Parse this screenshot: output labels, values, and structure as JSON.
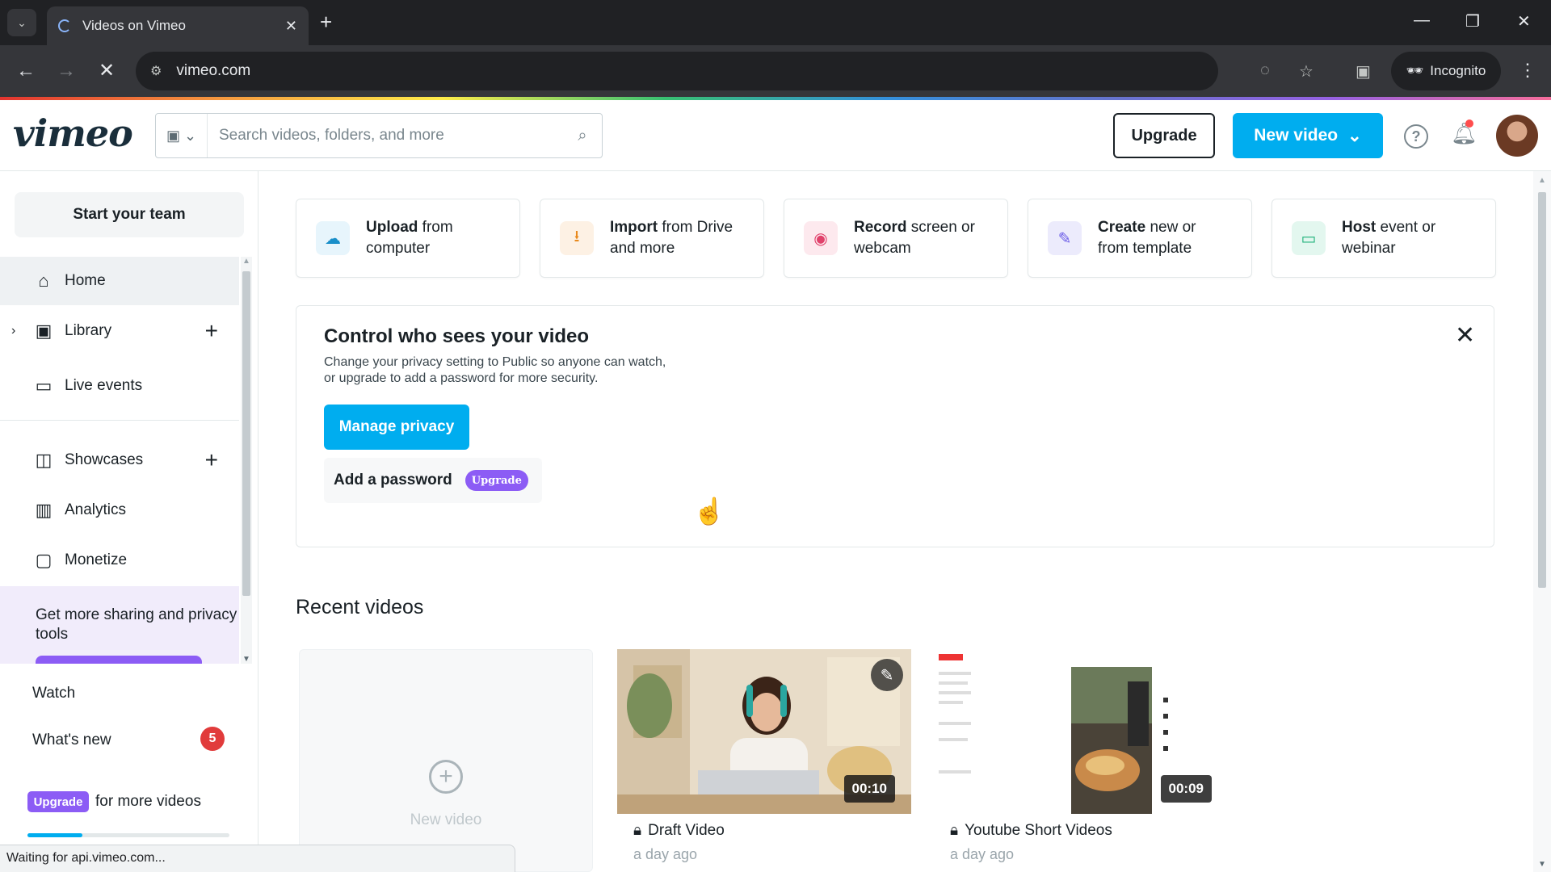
{
  "browser": {
    "tab_title": "Videos on Vimeo",
    "url": "vimeo.com",
    "incognito_label": "Incognito",
    "status_text": "Waiting for api.vimeo.com..."
  },
  "header": {
    "logo": "vimeo",
    "search_placeholder": "Search videos, folders, and more",
    "upgrade_label": "Upgrade",
    "new_video_label": "New video"
  },
  "sidebar": {
    "start_team": "Start your team",
    "items": [
      {
        "label": "Home"
      },
      {
        "label": "Library"
      },
      {
        "label": "Live events"
      },
      {
        "label": "Showcases"
      },
      {
        "label": "Analytics"
      },
      {
        "label": "Monetize"
      }
    ],
    "promo_text": "Get more sharing and privacy tools",
    "watch_label": "Watch",
    "whats_new_label": "What's new",
    "whats_new_count": "5",
    "upgrade_pill": "Upgrade",
    "upgrade_text": "for more videos",
    "usage_fraction": 0.27
  },
  "actions": [
    {
      "bold": "Upload",
      "rest": "from",
      "line2": "computer",
      "icon": "upload-cloud-icon",
      "tint": "#e7f5fc",
      "color": "#1a8fc9"
    },
    {
      "bold": "Import",
      "rest": "from Drive",
      "line2": "and more",
      "icon": "download-icon",
      "tint": "#fdf1e4",
      "color": "#e98a1e"
    },
    {
      "bold": "Record",
      "rest": "screen or",
      "line2": "webcam",
      "icon": "record-icon",
      "tint": "#fde9ee",
      "color": "#e0416b"
    },
    {
      "bold": "Create",
      "rest": "new or",
      "line2": "from template",
      "icon": "create-edit-icon",
      "tint": "#ecebfc",
      "color": "#6b5ce7"
    },
    {
      "bold": "Host",
      "rest": "event or",
      "line2": "webinar",
      "icon": "camera-icon",
      "tint": "#e3f7ef",
      "color": "#1fb27a"
    }
  ],
  "privacy": {
    "title": "Control who sees your video",
    "desc_line1": "Change your privacy setting to Public so anyone can watch,",
    "desc_line2": "or upgrade to add a password for more security.",
    "manage_label": "Manage privacy",
    "password_label": "Add a password",
    "upgrade_pill": "Upgrade"
  },
  "recent": {
    "title": "Recent videos",
    "new_video_label": "New video",
    "videos": [
      {
        "title": "Draft Video",
        "date": "a day ago",
        "duration": "00:10"
      },
      {
        "title": "Youtube Short Videos",
        "date": "a day ago",
        "duration": "00:09"
      }
    ]
  },
  "colors": {
    "accent": "#00adef",
    "upgrade_purple": "#8c5cf5",
    "badge_red": "#e13b3b"
  }
}
